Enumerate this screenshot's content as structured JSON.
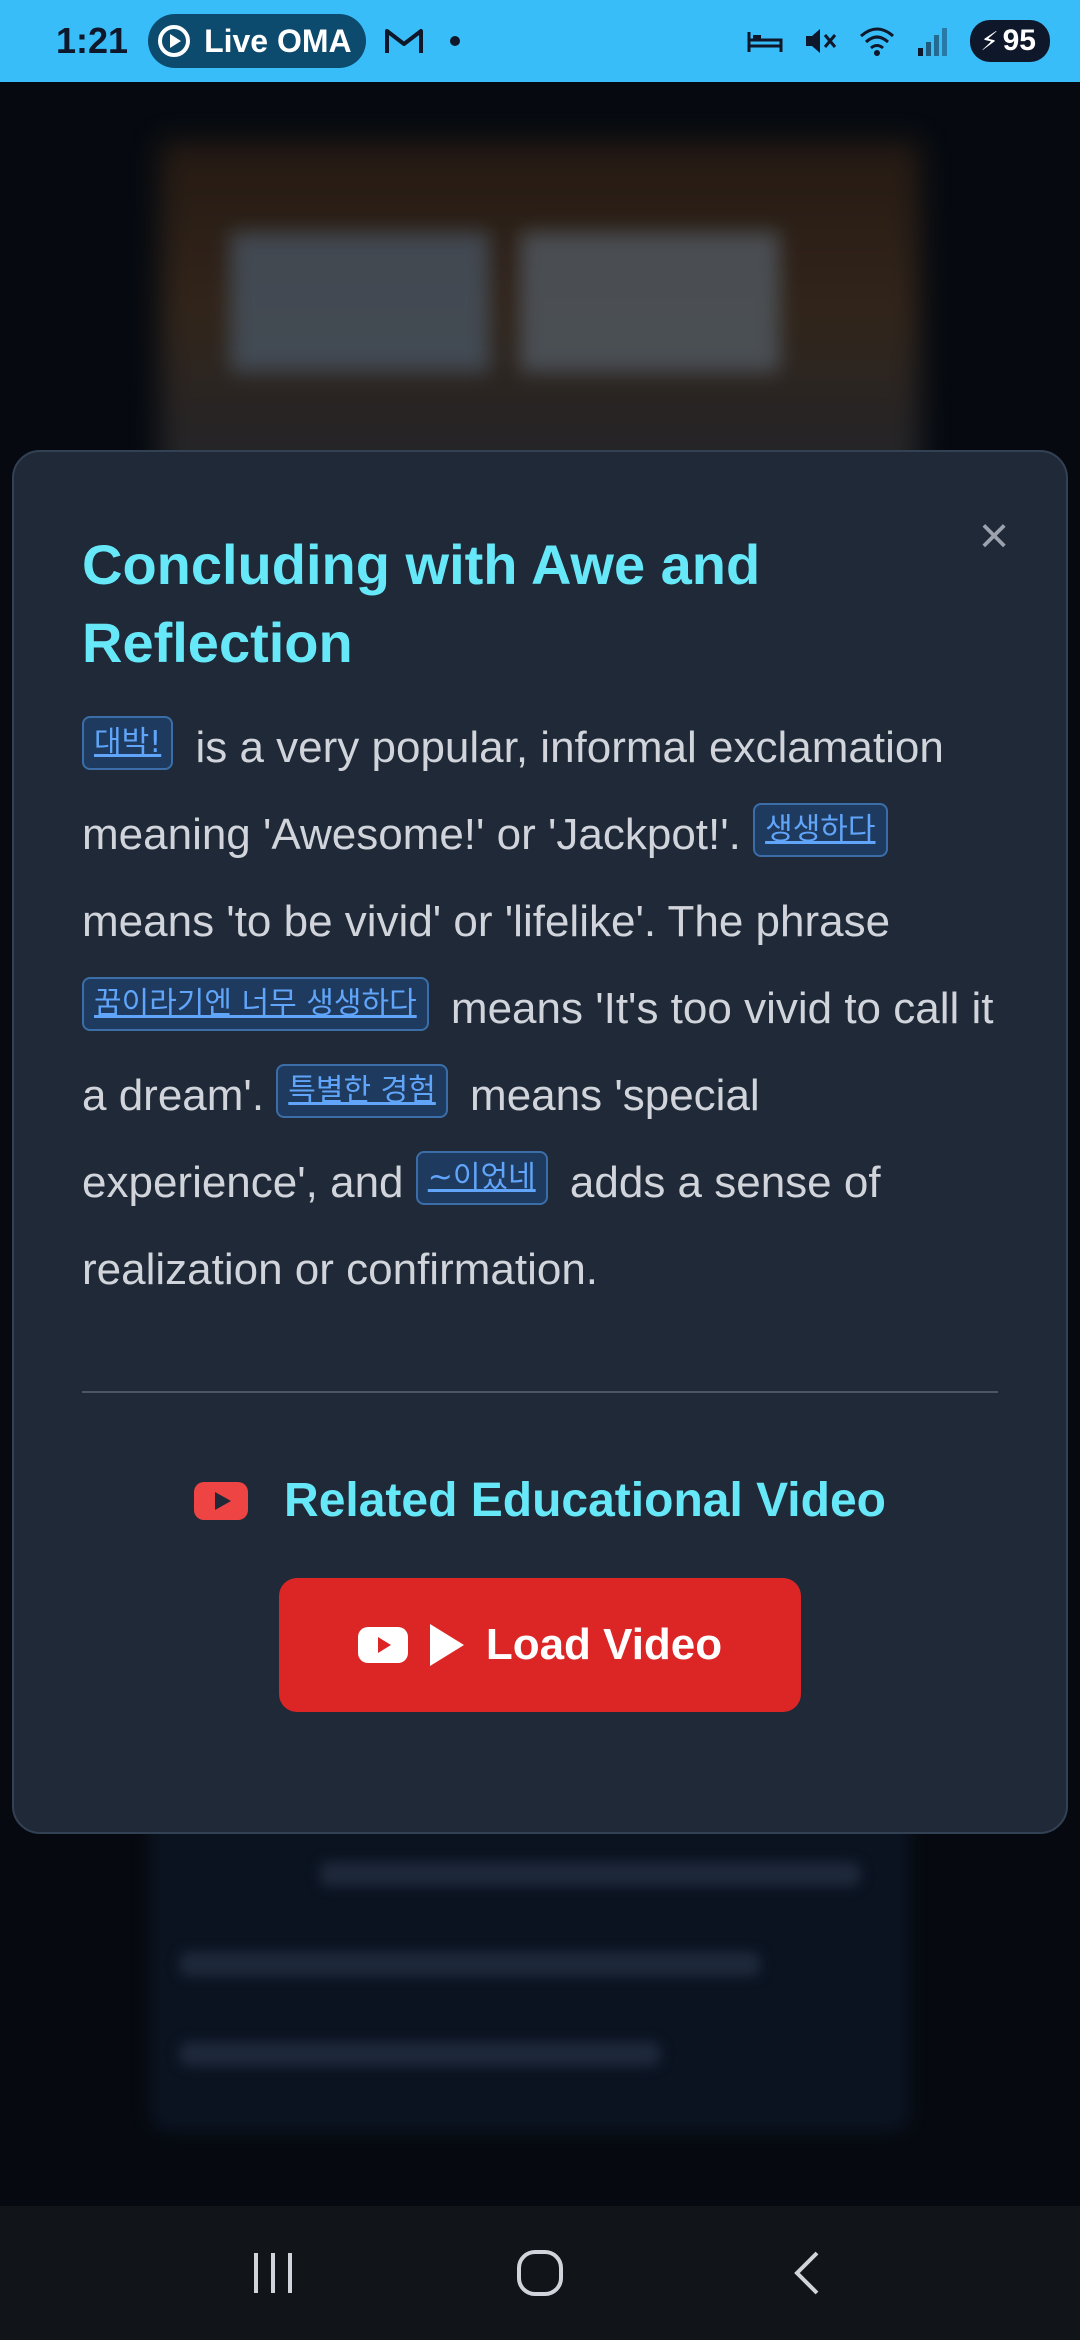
{
  "status": {
    "time": "1:21",
    "live_pill": "Live OMA",
    "battery": "95",
    "icons": [
      "play-circle-icon",
      "gmail-icon",
      "notification-dot",
      "bed-icon",
      "mute-icon",
      "wifi-icon",
      "signal-icon",
      "battery-icon"
    ]
  },
  "modal": {
    "title": "Concluding with Awe and Reflection",
    "close_icon": "close-icon",
    "body": {
      "chip1": "대박!",
      "text1": " is a very popular, informal exclamation meaning 'Awesome!' or 'Jackpot!'. ",
      "chip2": "생생하다",
      "text2": " means 'to be vivid' or 'lifelike'. The phrase ",
      "chip3": "꿈이라기엔 너무 생생하다",
      "text3": " means 'It's too vivid to call it a dream'. ",
      "chip4": "특별한 경험",
      "text4": " means 'special experience', and ",
      "chip5": "~이었네",
      "text5": " adds a sense of realization or confirmation."
    },
    "related_title": "Related Educational Video",
    "load_button": "Load Video"
  },
  "colors": {
    "accent_cyan": "#67e8f9",
    "chip_blue": "#60a5fa",
    "button_red": "#dc2626",
    "modal_bg": "#1f2937",
    "status_bar": "#38bdf8"
  },
  "nav": {
    "recents": "recents-icon",
    "home": "home-icon",
    "back": "back-icon"
  }
}
